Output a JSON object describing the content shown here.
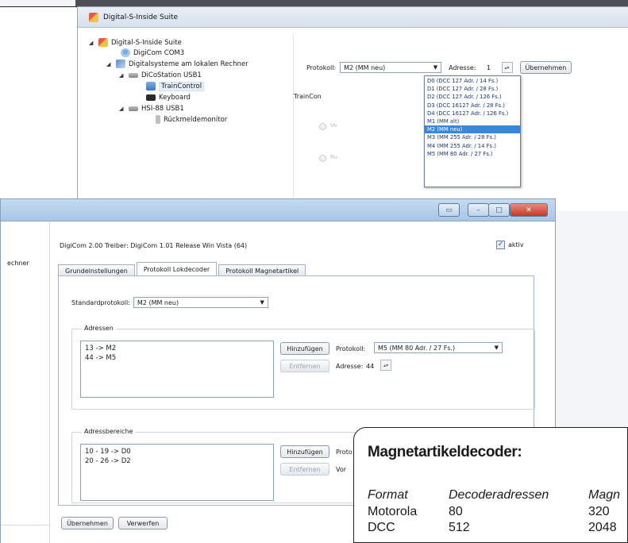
{
  "back_window": {
    "title": "Digital-S-Inside Suite",
    "tree": [
      {
        "label": "Digital-S-Inside Suite"
      },
      {
        "label": "DigiCom COM3"
      },
      {
        "label": "Digitalsysteme am lokalen Rechner"
      },
      {
        "label": "DiCoStation USB1"
      },
      {
        "label": "TrainControl"
      },
      {
        "label": "Keyboard"
      },
      {
        "label": "HSI-88 USB1"
      },
      {
        "label": "Rückmeldemonitor"
      }
    ],
    "protokoll_label": "Protokoll:",
    "protokoll_value": "M2 (MM neu)",
    "adresse_label": "Adresse:",
    "adresse_value": "1",
    "uebernehmen": "Übernehmen",
    "traincon_label": "TrainCon",
    "dropdown_items": [
      "D0 (DCC 127 Adr. / 14 Fs.)",
      "D1 (DCC 127 Adr. / 28 Fs.)",
      "D2 (DCC 127 Adr. / 126 Fs.)",
      "D3 (DCC 16127 Adr. / 28 Fs.)",
      "D4 (DCC 16127 Adr. / 126 Fs.)",
      "M1 (MM alt)",
      "M2 (MM neu)",
      "M3 (MM 255 Adr. / 28 Fs.)",
      "M4 (MM 255 Adr. / 14 Fs.)",
      "M5 (MM 80 Adr. / 27 Fs.)"
    ],
    "dropdown_selected_index": 6
  },
  "front_window": {
    "left_cut_text": "echner",
    "info_line": "DigiCom  2.00  Treiber:  DigiCom 1.01 Release Win Vista (64)",
    "aktiv_label": "aktiv",
    "aktiv_checked": true,
    "tabs": [
      {
        "label": "Grundeinstellungen"
      },
      {
        "label": "Protokoll Lokdecoder"
      },
      {
        "label": "Protokoll Magnetartikel"
      }
    ],
    "active_tab_index": 1,
    "standardprotokoll_label": "Standardprotokoll:",
    "standardprotokoll_value": "M2 (MM neu)",
    "adressen": {
      "legend": "Adressen",
      "items": [
        "13 -> M2",
        "44 -> M5"
      ],
      "add_button": "Hinzufügen",
      "remove_button": "Entfernen",
      "protokoll_label": "Protokoll:",
      "protokoll_value": "M5 (MM 80 Adr. / 27 Fs.)",
      "adresse_label": "Adresse:",
      "adresse_value": "44"
    },
    "adressbereiche": {
      "legend": "Adressbereiche",
      "items": [
        "10 - 19 -> D0",
        "20 - 26 -> D2"
      ],
      "add_button": "Hinzufügen",
      "remove_button": "Entfernen",
      "protokoll_label_cut": "Proto",
      "von_label_cut": "Vor"
    },
    "bottom_buttons": {
      "apply": "Übernehmen",
      "discard": "Verwerfen"
    }
  },
  "info_card": {
    "heading": "Magnetartikeldecoder:",
    "columns": [
      "Format",
      "Decoderadressen",
      "Magn"
    ],
    "rows": [
      [
        "Motorola",
        "80",
        "320"
      ],
      [
        "DCC",
        "512",
        "2048"
      ]
    ]
  }
}
